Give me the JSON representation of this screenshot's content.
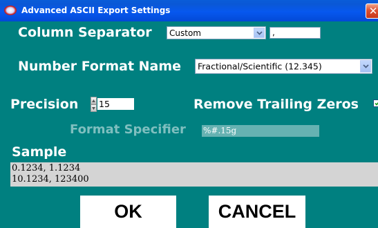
{
  "window": {
    "title": "Advanced ASCII Export Settings",
    "background_color": "#008080",
    "titlebar_color": "#0758ef",
    "icon": "app-logo-icon",
    "close_icon": "close-icon"
  },
  "column_separator": {
    "label": "Column Separator",
    "selected": "Custom",
    "custom_value": ","
  },
  "number_format": {
    "label": "Number Format Name",
    "selected": "Fractional/Scientific (12.345)"
  },
  "precision": {
    "label": "Precision",
    "value": "15"
  },
  "remove_trailing_zeros": {
    "label": "Remove Trailing Zeros",
    "checked": true
  },
  "format_specifier": {
    "label": "Format Specifier",
    "value": "%#.15g",
    "enabled": false
  },
  "sample": {
    "label": "Sample",
    "lines": [
      "0.1234, 1.1234",
      "10.1234, 123400"
    ]
  },
  "buttons": {
    "ok": "OK",
    "cancel": "CANCEL"
  }
}
